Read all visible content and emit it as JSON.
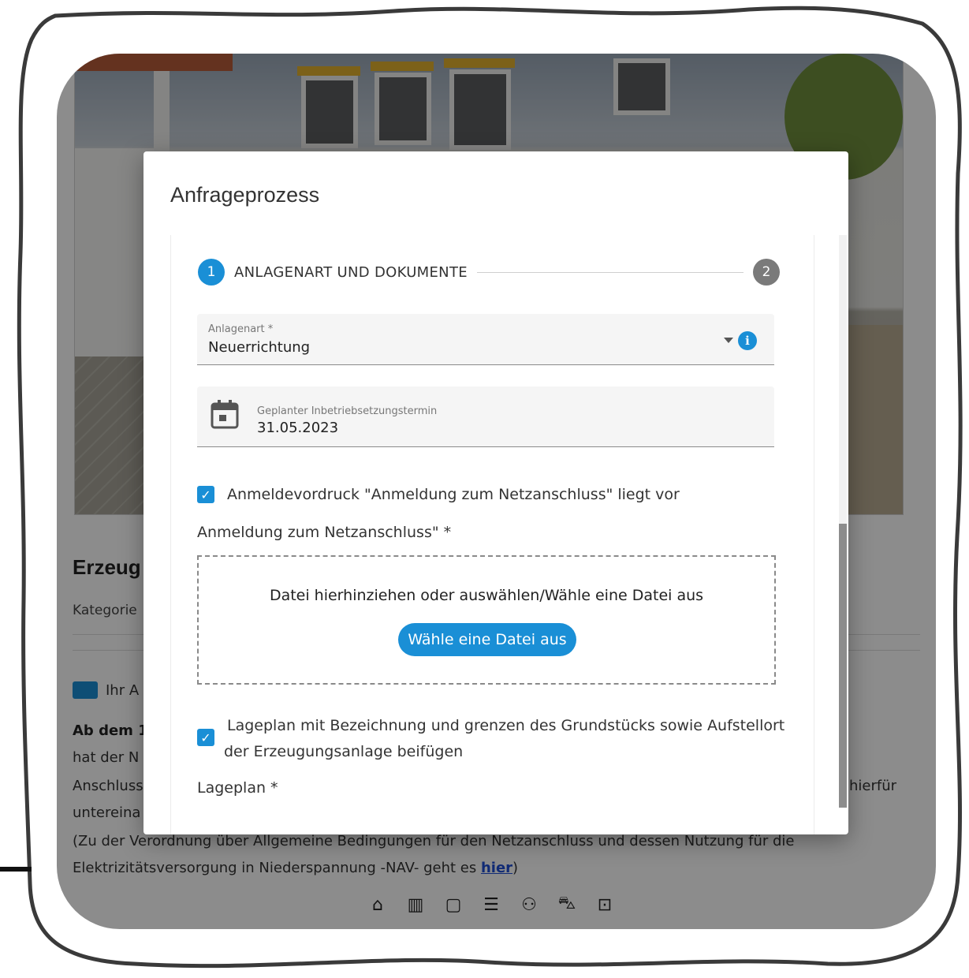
{
  "background_page": {
    "heading": "Erzeug",
    "category_label": "Kategorie",
    "section_heading": "Ihr A",
    "text_lines": [
      {
        "bold": "Ab dem 1.",
        "rest": ""
      },
      {
        "bold": "",
        "rest": "hat der N"
      },
      {
        "bold": "",
        "rest": "Anschluss"
      },
      {
        "bold": "",
        "rest": "untereina"
      },
      {
        "bold": "",
        "rest": "(Zu der Verordnung über Allgemeine Bedingungen für den Netzanschluss und dessen Nutzung für die"
      }
    ],
    "last_line_prefix": "Elektrizitätsversorgung in Niederspannung -NAV- geht es ",
    "last_line_link": "hier",
    "last_line_suffix": ")",
    "right_fragment": "hierfür",
    "bottom_nav_icons": [
      "home-icon",
      "building-icon",
      "calendar-icon",
      "list-icon",
      "users-icon",
      "cart-icon",
      "upload-icon"
    ]
  },
  "modal": {
    "title": "Anfrageprozess",
    "stepper": {
      "step1_number": "1",
      "step1_label": "ANLAGENART UND DOKUMENTE",
      "step2_number": "2"
    },
    "anlagenart": {
      "label": "Anlagenart *",
      "value": "Neuerrichtung"
    },
    "date_field": {
      "label": "Geplanter Inbetriebsetzungstermin",
      "value": "31.05.2023"
    },
    "checkbox1": {
      "checked": true,
      "label": "Anmeldevordruck \"Anmeldung zum Netzanschluss\" liegt vor"
    },
    "upload1": {
      "label": "Anmeldung zum Netzanschluss\" *",
      "drop_text": "Datei hierhinziehen oder auswählen/Wähle eine Datei aus",
      "button_label": "Wähle eine Datei aus"
    },
    "checkbox2": {
      "checked": true,
      "label_line1": "Lageplan mit Bezeichnung und grenzen des Grundstücks sowie Aufstellort",
      "label_line2": "der Erzeugungsanlage beifügen"
    },
    "upload2": {
      "label": "Lageplan *"
    }
  },
  "colors": {
    "accent": "#1a8fd6",
    "step_inactive": "#7a7a7a",
    "overlay": "rgba(0,0,0,0.45)"
  }
}
